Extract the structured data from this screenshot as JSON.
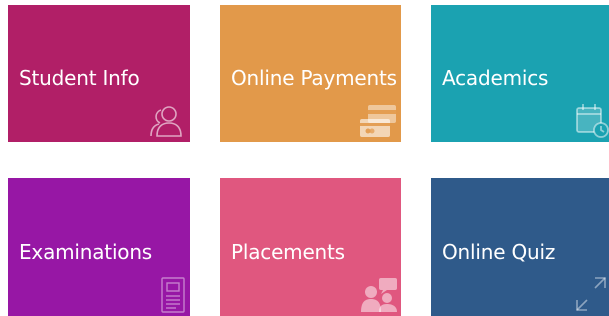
{
  "tiles": [
    {
      "label": "Student Info",
      "icon": "users-icon",
      "color": "#b11f67"
    },
    {
      "label": "Online Payments",
      "icon": "payment-cards-icon",
      "color": "#e2994a"
    },
    {
      "label": "Academics",
      "icon": "calendar-clock-icon",
      "color": "#1ba2b1"
    },
    {
      "label": "Examinations",
      "icon": "document-icon",
      "color": "#9717a5"
    },
    {
      "label": "Placements",
      "icon": "meeting-icon",
      "color": "#e0577f"
    },
    {
      "label": "Online Quiz",
      "icon": "expand-arrows-icon",
      "color": "#2f5a8a"
    }
  ]
}
